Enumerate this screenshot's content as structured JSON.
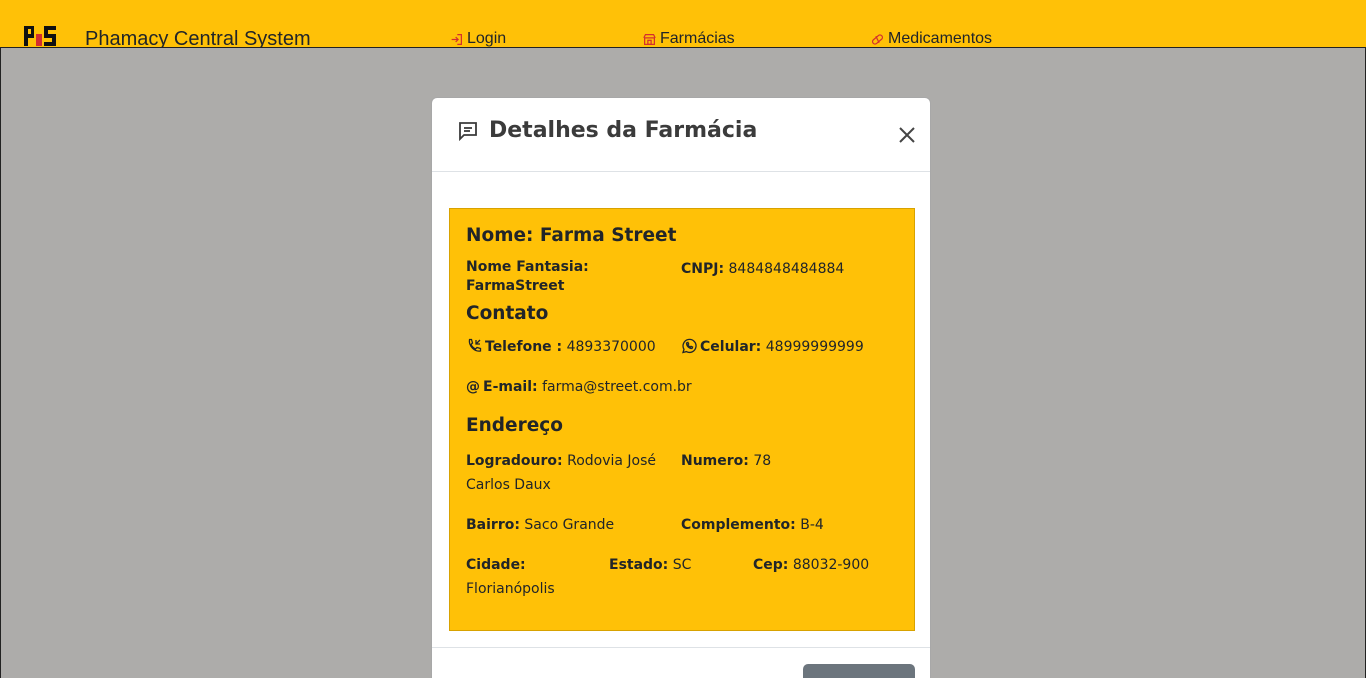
{
  "navbar": {
    "brand": "Phamacy Central System",
    "links": {
      "login": "Login",
      "farmacias": "Farmácias",
      "medicamentos": "Medicamentos"
    }
  },
  "modal": {
    "title": "Detalhes da Farmácia",
    "nome_heading": "Nome: Farma Street",
    "nome_fantasia_label": "Nome Fantasia:",
    "nome_fantasia_value": "FarmaStreet",
    "cnpj_label": "CNPJ:",
    "cnpj_value": "8484848484884",
    "contato_heading": "Contato",
    "telefone_label": "Telefone :",
    "telefone_value": "4893370000",
    "celular_label": "Celular:",
    "celular_value": "48999999999",
    "email_label": "E-mail:",
    "email_value": "farma@street.com.br",
    "endereco_heading": "Endereço",
    "logradouro_label": "Logradouro:",
    "logradouro_value": "Rodovia José",
    "logradouro_value_2": "Carlos Daux",
    "numero_label": "Numero:",
    "numero_value": "78",
    "bairro_label": "Bairro:",
    "bairro_value": "Saco Grande",
    "complemento_label": "Complemento:",
    "complemento_value": "B-4",
    "cidade_label": "Cidade:",
    "cidade_value": "Florianópolis",
    "estado_label": "Estado:",
    "estado_value": "SC",
    "cep_label": "Cep:",
    "cep_value": "88032-900"
  },
  "colors": {
    "accent": "#ffc107",
    "backdrop": "#adacaa",
    "footer_button": "#6c757d"
  }
}
